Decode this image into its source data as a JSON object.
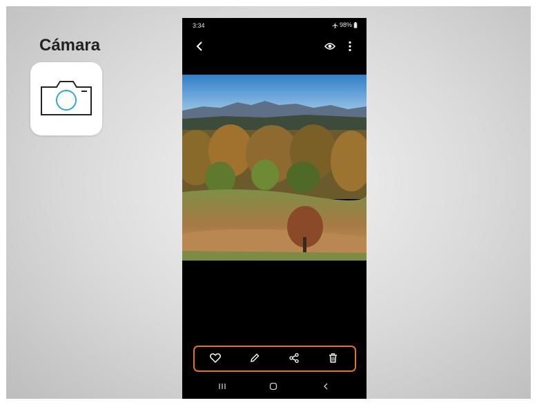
{
  "slide": {
    "app_title": "Cámara",
    "app_icon": "camera-icon",
    "accent_color": "#e8702a",
    "icon_color": "#2ea8d8"
  },
  "phone": {
    "status_bar": {
      "time": "3:34",
      "battery": "98%",
      "icons": [
        "airplane-mode-icon",
        "battery-icon"
      ]
    },
    "top_bar": {
      "icons": [
        "back-arrow-icon",
        "eye-icon",
        "more-options-icon"
      ]
    },
    "photo": {
      "description_icon": "landscape-photo"
    },
    "action_bar": {
      "icons": [
        "favorite-heart-icon",
        "edit-pencil-icon",
        "share-icon",
        "delete-trash-icon"
      ]
    },
    "nav_bar": {
      "icons": [
        "recent-apps-icon",
        "home-icon",
        "back-icon"
      ]
    }
  }
}
